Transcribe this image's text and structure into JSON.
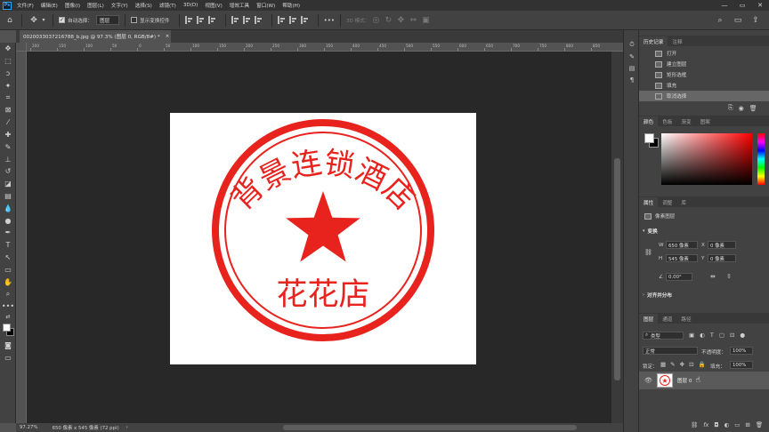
{
  "menu": {
    "logo": "Ps",
    "items": [
      "文件(F)",
      "编辑(E)",
      "图像(I)",
      "图层(L)",
      "文字(Y)",
      "选择(S)",
      "滤镜(T)",
      "3D(D)",
      "视图(V)",
      "增效工具",
      "窗口(W)",
      "帮助(H)"
    ],
    "window_controls": {
      "minimize": "—",
      "maximize": "▭",
      "close": "✕"
    }
  },
  "options": {
    "auto_select_label": "自动选择：",
    "auto_select_target": "图层",
    "show_transform_label": "显示变换控件",
    "more_label": "•••",
    "mode_3d_label": "3D 模式："
  },
  "document": {
    "tab_title": "0020033037216788_b.jpg @ 97.3% (图层 0, RGB/8#) *",
    "tab_close": "×",
    "ruler_ticks": [
      "200",
      "150",
      "100",
      "50",
      "0",
      "50",
      "100",
      "150",
      "200",
      "250",
      "300",
      "350",
      "400",
      "450",
      "500",
      "550",
      "600",
      "650",
      "700",
      "750",
      "800",
      "850"
    ]
  },
  "seal": {
    "arc_text": "背景连锁酒店",
    "center_text": "花花店",
    "color": "#e8231e"
  },
  "status": {
    "zoom": "97.27%",
    "doc_info": "650 像素 x 545 像素 (72 ppi)",
    "arrow": "›"
  },
  "history": {
    "tabs": [
      "历史记录",
      "注释"
    ],
    "items": [
      "打开",
      "建立图层",
      "矩形选框",
      "填充",
      "取消选择"
    ],
    "selected_index": 4
  },
  "color_panel": {
    "tabs": [
      "颜色",
      "色板",
      "渐变",
      "图案"
    ],
    "foreground": "#ffffff",
    "background": "#000000",
    "hue": "#ff0000"
  },
  "properties": {
    "tabs": [
      "属性",
      "调整",
      "库"
    ],
    "kind_label": "像素图层",
    "transform_title": "变换",
    "w_label": "W",
    "w_value": "650 像素",
    "h_label": "H",
    "h_value": "545 像素",
    "x_label": "X",
    "x_value": "0 像素",
    "y_label": "Y",
    "y_value": "0 像素",
    "angle_value": "0.00°",
    "align_title": "对齐并分布"
  },
  "layers": {
    "tabs": [
      "图层",
      "通道",
      "路径"
    ],
    "filter_label": "类型",
    "blend_mode": "正常",
    "opacity_label": "不透明度：",
    "opacity_value": "100%",
    "lock_label": "锁定：",
    "fill_label": "填充：",
    "fill_value": "100%",
    "layer_name": "图层 0",
    "footer_icons": [
      "fx"
    ]
  }
}
